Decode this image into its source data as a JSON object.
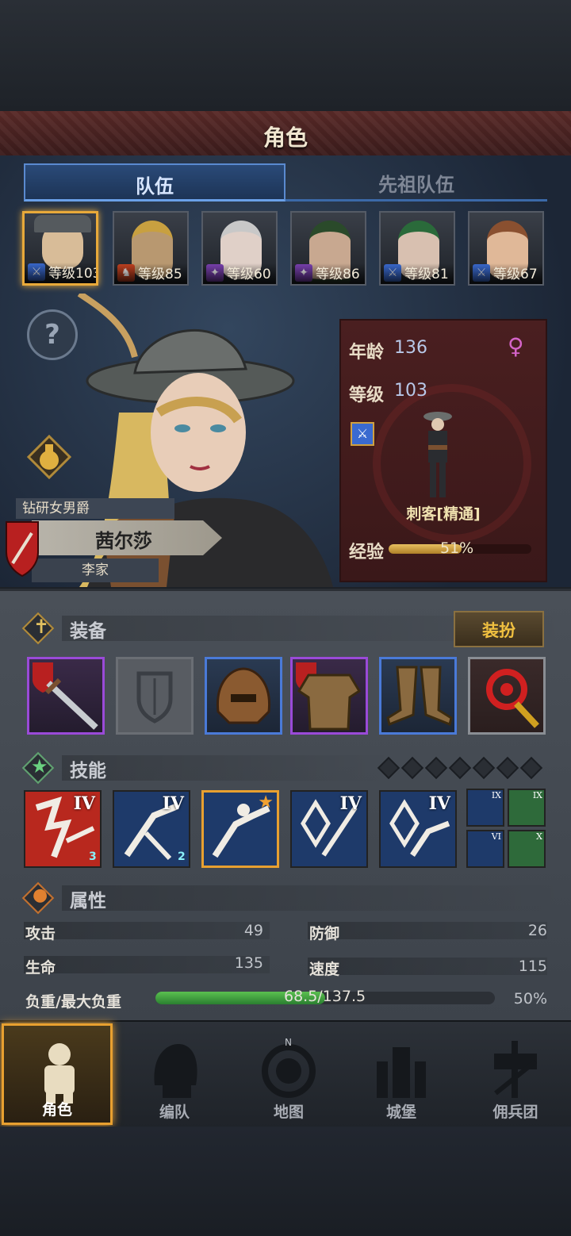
{
  "screen_title": "角色",
  "tabs": [
    {
      "label": "队伍",
      "active": true
    },
    {
      "label": "先祖队伍",
      "active": false
    }
  ],
  "roster": [
    {
      "level_text": "等级103",
      "class_icon": "sword-icon",
      "selected": true
    },
    {
      "level_text": "等级85",
      "class_icon": "beast-icon",
      "selected": false
    },
    {
      "level_text": "等级60",
      "class_icon": "staff-icon",
      "selected": false
    },
    {
      "level_text": "等级86",
      "class_icon": "staff-icon",
      "selected": false
    },
    {
      "level_text": "等级81",
      "class_icon": "sword-icon",
      "selected": false
    },
    {
      "level_text": "等级67",
      "class_icon": "sword-icon",
      "selected": false
    }
  ],
  "hero": {
    "title": "钻研女男爵",
    "name": "茜尔莎",
    "family": "李家",
    "age_label": "年龄",
    "age": "136",
    "level_label": "等级",
    "level": "103",
    "class_name": "刺客[精通]",
    "exp_label": "经验",
    "exp_text": "51%",
    "exp_percent": 51
  },
  "equipment_section": {
    "label": "装备",
    "dress_button": "装扮"
  },
  "skills_section": {
    "label": "技能",
    "slot_count": 7
  },
  "skills": [
    {
      "rank": "IV",
      "gems": "3",
      "color": "#b8281e"
    },
    {
      "rank": "IV",
      "gems": "2",
      "color": "#1e3a6a"
    },
    {
      "rank": "",
      "gems": "",
      "color": "#1e3a6a"
    },
    {
      "rank": "IV",
      "gems": "",
      "color": "#1e3a6a"
    },
    {
      "rank": "IV",
      "gems": "",
      "color": "#1e3a6a"
    }
  ],
  "mini_skills": [
    {
      "rank": "IX",
      "color": "#1e3a6a"
    },
    {
      "rank": "IX",
      "color": "#2e6a3a"
    },
    {
      "rank": "VI",
      "color": "#1e3a6a"
    },
    {
      "rank": "X",
      "color": "#2e6a3a"
    }
  ],
  "attributes_section": {
    "label": "属性"
  },
  "stats": {
    "attack_label": "攻击",
    "attack": "49",
    "defense_label": "防御",
    "defense": "26",
    "hp_label": "生命",
    "hp": "135",
    "speed_label": "速度",
    "speed": "115",
    "load_label": "负重/最大负重",
    "load_text": "68.5/137.5",
    "load_percent_text": "50%",
    "load_percent": 50
  },
  "nav": [
    {
      "label": "角色",
      "active": true
    },
    {
      "label": "编队",
      "active": false
    },
    {
      "label": "地图",
      "active": false
    },
    {
      "label": "城堡",
      "active": false
    },
    {
      "label": "佣兵团",
      "active": false
    }
  ],
  "compass_label": "N",
  "colors": {
    "accent": "#e8a030",
    "female": "#d464c8",
    "load_bar": "#4ab040",
    "exp_bar": "#d4a848"
  }
}
